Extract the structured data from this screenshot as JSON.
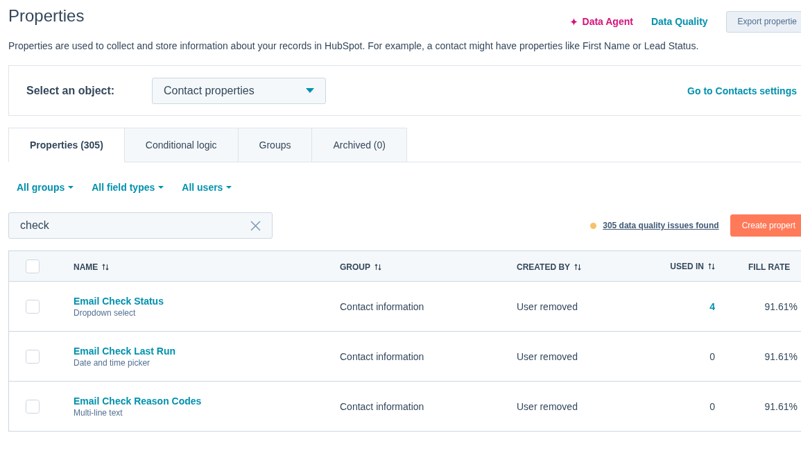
{
  "header": {
    "title": "Properties",
    "actions": [
      {
        "kind": "agent",
        "label": "Data Agent"
      },
      {
        "kind": "link",
        "label": "Data Quality"
      },
      {
        "kind": "button",
        "label": "Export propertie"
      }
    ]
  },
  "description": "Properties are used to collect and store information about your records in HubSpot. For example, a contact might have properties like First Name or Lead Status.",
  "object_selector": {
    "label": "Select an object:",
    "value": "Contact properties",
    "settings_link": "Go to Contacts settings"
  },
  "tabs": [
    {
      "label": "Properties (305)",
      "selected": true
    },
    {
      "label": "Conditional logic",
      "selected": false
    },
    {
      "label": "Groups",
      "selected": false
    },
    {
      "label": "Archived (0)",
      "selected": false
    }
  ],
  "filters": [
    {
      "label": "All groups"
    },
    {
      "label": "All field types"
    },
    {
      "label": "All users"
    }
  ],
  "search": {
    "value": "check"
  },
  "data_quality_link": "305 data quality issues found",
  "create_button": "Create propert",
  "table": {
    "select_all": {
      "checked": false
    },
    "columns": [
      {
        "label": "NAME",
        "sortable": true
      },
      {
        "label": "GROUP",
        "sortable": true
      },
      {
        "label": "CREATED BY",
        "sortable": true
      },
      {
        "label": "USED IN",
        "sortable": true
      },
      {
        "label": "FILL RATE",
        "sortable": false
      }
    ],
    "rows": [
      {
        "selected": false,
        "name": "Email Check Status",
        "field_type": "Dropdown select",
        "group": "Contact information",
        "created_by": "User removed",
        "used_in": {
          "text": "4",
          "linked": true
        },
        "fill_rate": "91.61%"
      },
      {
        "selected": false,
        "name": "Email Check Last Run",
        "field_type": "Date and time picker",
        "group": "Contact information",
        "created_by": "User removed",
        "used_in": {
          "text": "0",
          "linked": false
        },
        "fill_rate": "91.61%"
      },
      {
        "selected": false,
        "name": "Email Check Reason Codes",
        "field_type": "Multi-line text",
        "group": "Contact information",
        "created_by": "User removed",
        "used_in": {
          "text": "0",
          "linked": false
        },
        "fill_rate": "91.61%"
      }
    ]
  }
}
